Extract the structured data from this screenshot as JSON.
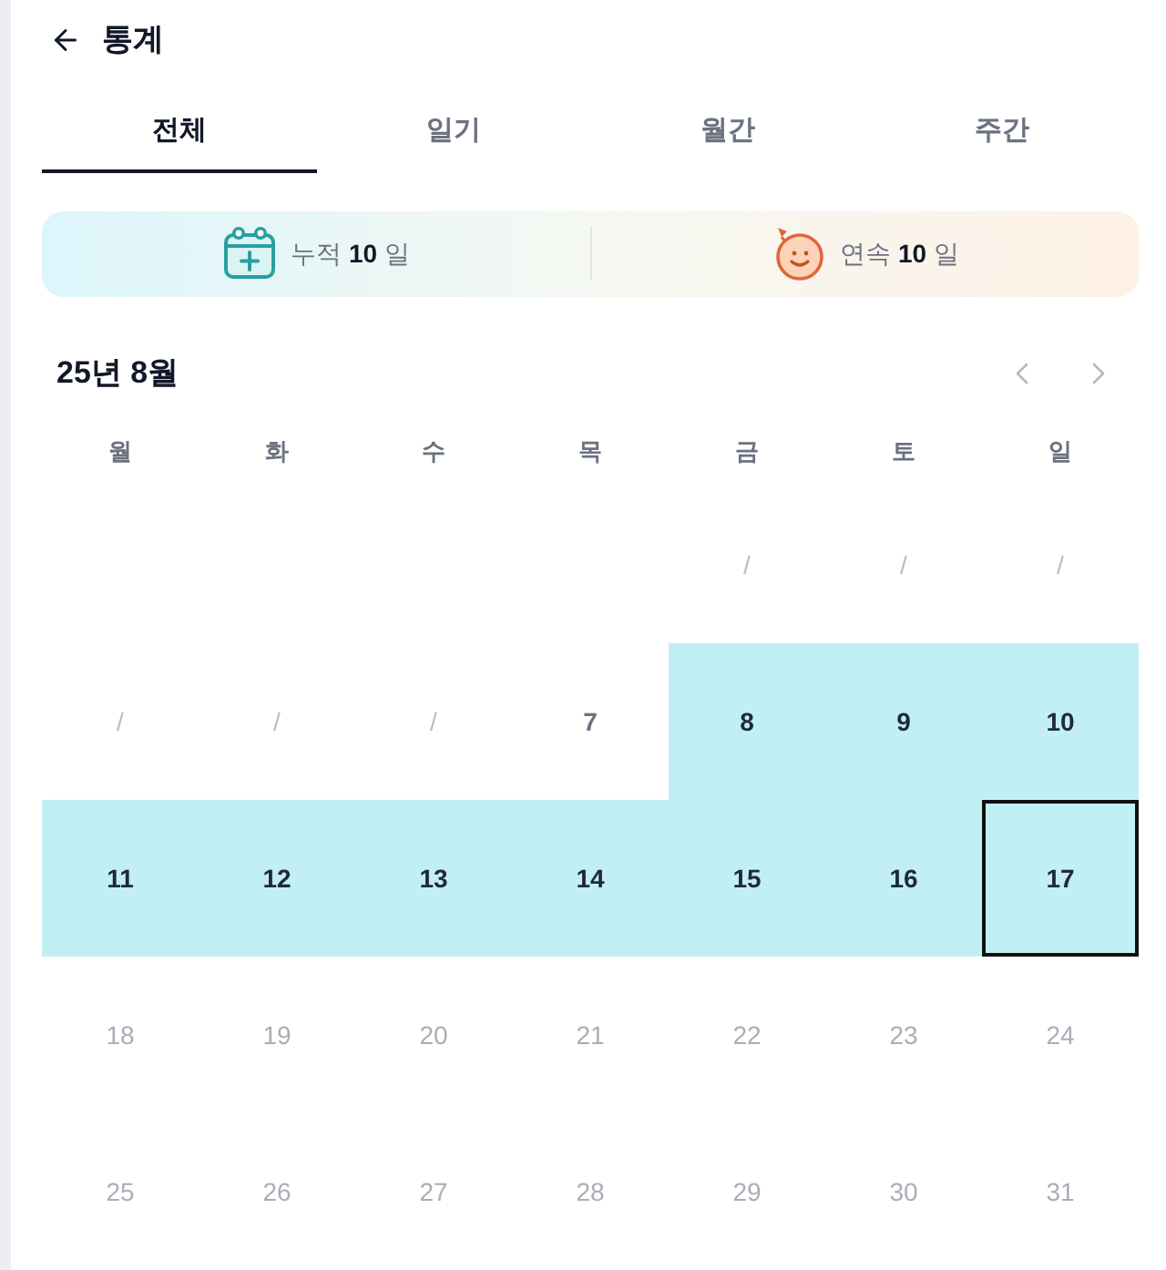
{
  "header": {
    "title": "통계"
  },
  "tabs": [
    {
      "label": "전체",
      "selected": true
    },
    {
      "label": "일기",
      "selected": false
    },
    {
      "label": "월간",
      "selected": false
    },
    {
      "label": "주간",
      "selected": false
    }
  ],
  "summary": [
    {
      "kind": "total",
      "text": "누적 **10** 일"
    },
    {
      "kind": "streak",
      "text": "연속 **10** 일"
    }
  ],
  "calendar": {
    "title": "25년 8월",
    "weekdays": [
      "월",
      "화",
      "수",
      "목",
      "금",
      "토",
      "일"
    ],
    "weeks": [
      [
        {
          "kind": "blank"
        },
        {
          "kind": "blank"
        },
        {
          "kind": "blank"
        },
        {
          "kind": "blank"
        },
        {
          "kind": "missed",
          "text": "/",
          "today": false
        },
        {
          "kind": "missed",
          "text": "/",
          "today": false
        },
        {
          "kind": "missed",
          "text": "/",
          "today": false
        }
      ],
      [
        {
          "kind": "missed",
          "text": "/",
          "today": false
        },
        {
          "kind": "missed",
          "text": "/",
          "today": false
        },
        {
          "kind": "missed",
          "text": "/",
          "today": false
        },
        {
          "kind": "past",
          "text": "7",
          "today": false
        },
        {
          "kind": "recorded",
          "text": "8",
          "today": false
        },
        {
          "kind": "recorded",
          "text": "9",
          "today": false
        },
        {
          "kind": "recorded",
          "text": "10",
          "today": false
        }
      ],
      [
        {
          "kind": "recorded",
          "text": "11",
          "today": false
        },
        {
          "kind": "recorded",
          "text": "12",
          "today": false
        },
        {
          "kind": "recorded",
          "text": "13",
          "today": false
        },
        {
          "kind": "recorded",
          "text": "14",
          "today": false
        },
        {
          "kind": "recorded",
          "text": "15",
          "today": false
        },
        {
          "kind": "recorded",
          "text": "16",
          "today": false
        },
        {
          "kind": "recorded",
          "text": "17",
          "today": true
        }
      ],
      [
        {
          "kind": "future",
          "text": "18",
          "today": false
        },
        {
          "kind": "future",
          "text": "19",
          "today": false
        },
        {
          "kind": "future",
          "text": "20",
          "today": false
        },
        {
          "kind": "future",
          "text": "21",
          "today": false
        },
        {
          "kind": "future",
          "text": "22",
          "today": false
        },
        {
          "kind": "future",
          "text": "23",
          "today": false
        },
        {
          "kind": "future",
          "text": "24",
          "today": false
        }
      ],
      [
        {
          "kind": "future",
          "text": "25",
          "today": false
        },
        {
          "kind": "future",
          "text": "26",
          "today": false
        },
        {
          "kind": "future",
          "text": "27",
          "today": false
        },
        {
          "kind": "future",
          "text": "28",
          "today": false
        },
        {
          "kind": "future",
          "text": "29",
          "today": false
        },
        {
          "kind": "future",
          "text": "30",
          "today": false
        },
        {
          "kind": "future",
          "text": "31",
          "today": false
        }
      ]
    ]
  }
}
